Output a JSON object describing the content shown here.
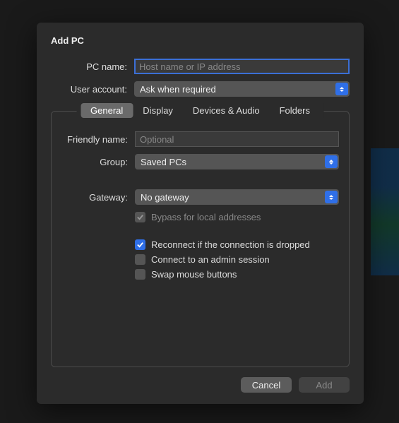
{
  "title": "Add PC",
  "top_form": {
    "pc_name_label": "PC name:",
    "pc_name_value": "",
    "pc_name_placeholder": "Host name or IP address",
    "user_account_label": "User account:",
    "user_account_value": "Ask when required"
  },
  "tabs": [
    "General",
    "Display",
    "Devices & Audio",
    "Folders"
  ],
  "active_tab": "General",
  "general": {
    "friendly_name_label": "Friendly name:",
    "friendly_name_value": "",
    "friendly_name_placeholder": "Optional",
    "group_label": "Group:",
    "group_value": "Saved PCs",
    "gateway_label": "Gateway:",
    "gateway_value": "No gateway",
    "bypass_label": "Bypass for local addresses",
    "bypass_checked": true,
    "bypass_enabled": false,
    "reconnect_label": "Reconnect if the connection is dropped",
    "reconnect_checked": true,
    "admin_label": "Connect to an admin session",
    "admin_checked": false,
    "swap_label": "Swap mouse buttons",
    "swap_checked": false
  },
  "buttons": {
    "cancel": "Cancel",
    "add": "Add",
    "add_enabled": false
  }
}
